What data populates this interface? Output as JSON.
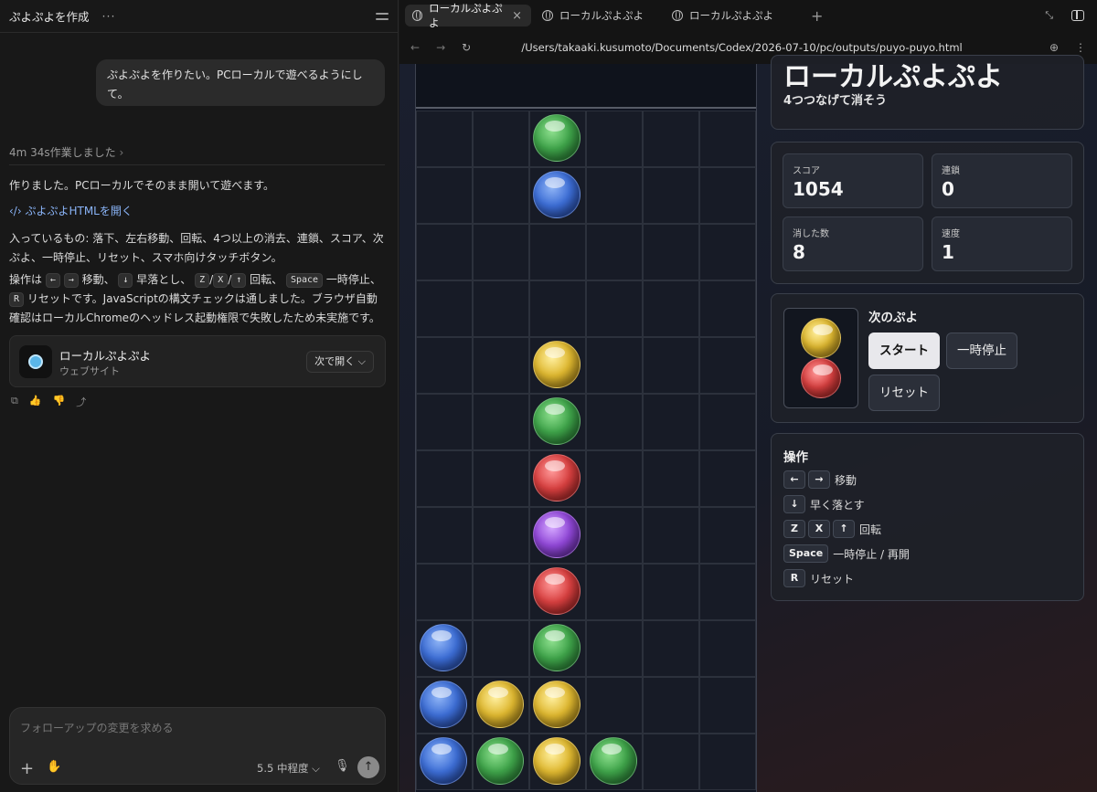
{
  "chat": {
    "title": "ぷよぷよを作成",
    "menu": "···",
    "user_message": "ぷよぷよを作りたい。PCローカルで遊べるようにして。",
    "worked": "4m 34s作業しました",
    "p1": "作りました。PCローカルでそのまま開いて遊べます。",
    "link": "ぷよぷよHTMLを開く",
    "p2": "入っているもの: 落下、左右移動、回転、4つ以上の消去、連鎖、スコア、次ぷよ、一時停止、リセット、スマホ向けタッチボタン。",
    "p3": {
      "a": "操作は",
      "k1": "←",
      "k2": "→",
      "b": "移動、",
      "k3": "↓",
      "c": "早落とし、",
      "k4": "Z",
      "s1": "/",
      "k5": "X",
      "s2": "/",
      "k6": "↑",
      "d": "回転、",
      "k7": "Space",
      "e": "一時停止、",
      "k8": "R",
      "f": "リセットです。JavaScriptの構文チェックは通しました。ブラウザ自動確認はローカルChromeのヘッドレス起動権限で失敗したため未実施です。"
    },
    "card": {
      "title": "ローカルぷよぷよ",
      "subtitle": "ウェブサイト",
      "open": "次で開く ⌵"
    },
    "composer": {
      "placeholder": "フォローアップの変更を求める",
      "model": "5.5 中程度 ⌵"
    }
  },
  "browser": {
    "tabs": [
      "ローカルぷよぷよ",
      "ローカルぷよぷよ",
      "ローカルぷよぷよ"
    ],
    "url": "/Users/takaaki.kusumoto/Documents/Codex/2026-07-10/pc/outputs/puyo-puyo.html"
  },
  "game": {
    "title": "ローカルぷよぷよ",
    "subtitle": "4つつなげて消そう",
    "stats": [
      {
        "label": "スコア",
        "value": "1054"
      },
      {
        "label": "連鎖",
        "value": "0"
      },
      {
        "label": "消した数",
        "value": "8"
      },
      {
        "label": "速度",
        "value": "1"
      }
    ],
    "next_label": "次のぷよ",
    "next": [
      "yellow",
      "red"
    ],
    "buttons": {
      "start": "スタート",
      "pause": "一時停止",
      "reset": "リセット"
    },
    "controls_title": "操作",
    "controls": [
      {
        "keys": [
          "←",
          "→"
        ],
        "label": "移動"
      },
      {
        "keys": [
          "↓"
        ],
        "label": "早く落とす"
      },
      {
        "keys": [
          "Z",
          "X",
          "↑"
        ],
        "label": "回転"
      },
      {
        "keys": [
          "Space"
        ],
        "label": "一時停止 / 再開"
      },
      {
        "keys": [
          "R"
        ],
        "label": "リセット"
      }
    ],
    "board_cols": 6,
    "board_rows": 12,
    "board": [
      {
        "col": 2,
        "row": 0,
        "color": "green"
      },
      {
        "col": 2,
        "row": 1,
        "color": "blue"
      },
      {
        "col": 2,
        "row": 4,
        "color": "yellow"
      },
      {
        "col": 2,
        "row": 5,
        "color": "green"
      },
      {
        "col": 2,
        "row": 6,
        "color": "red"
      },
      {
        "col": 2,
        "row": 7,
        "color": "purple"
      },
      {
        "col": 2,
        "row": 8,
        "color": "red"
      },
      {
        "col": 0,
        "row": 9,
        "color": "blue"
      },
      {
        "col": 2,
        "row": 9,
        "color": "green"
      },
      {
        "col": 0,
        "row": 10,
        "color": "blue"
      },
      {
        "col": 1,
        "row": 10,
        "color": "yellow"
      },
      {
        "col": 2,
        "row": 10,
        "color": "yellow"
      },
      {
        "col": 0,
        "row": 11,
        "color": "blue"
      },
      {
        "col": 1,
        "row": 11,
        "color": "green"
      },
      {
        "col": 2,
        "row": 11,
        "color": "yellow"
      },
      {
        "col": 3,
        "row": 11,
        "color": "green"
      }
    ]
  }
}
